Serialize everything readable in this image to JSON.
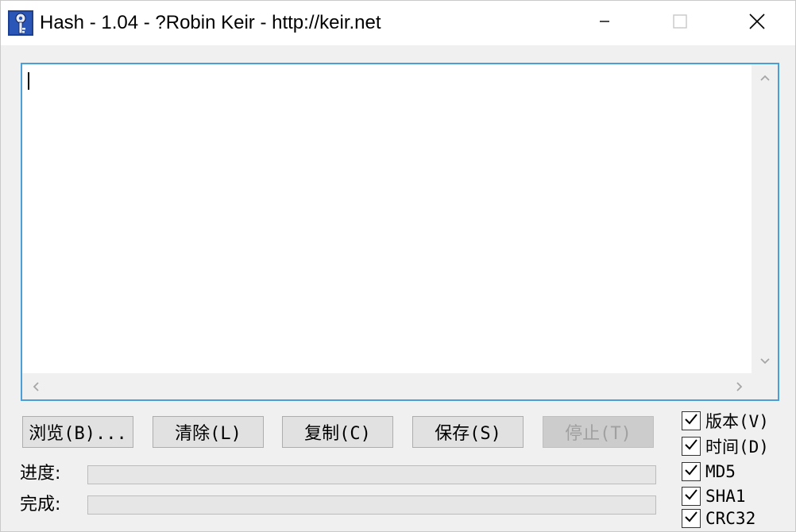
{
  "window": {
    "title": "Hash - 1.04 - ?Robin Keir - http://keir.net"
  },
  "text_area": {
    "value": ""
  },
  "buttons": {
    "browse": "浏览(B)...",
    "clear": "清除(L)",
    "copy": "复制(C)",
    "save": "保存(S)",
    "stop": "停止(T)"
  },
  "progress": {
    "progress_label": "进度:",
    "progress_value": 0,
    "done_label": "完成:",
    "done_value": 0
  },
  "options": [
    {
      "label": "版本(V)",
      "checked": true
    },
    {
      "label": "时间(D)",
      "checked": true
    },
    {
      "label": "MD5",
      "checked": true
    },
    {
      "label": "SHA1",
      "checked": true
    },
    {
      "label": "CRC32",
      "checked": true
    }
  ],
  "icons": {
    "app": "key-icon",
    "minimize": "minimize-icon",
    "maximize": "maximize-icon",
    "close": "close-icon"
  }
}
